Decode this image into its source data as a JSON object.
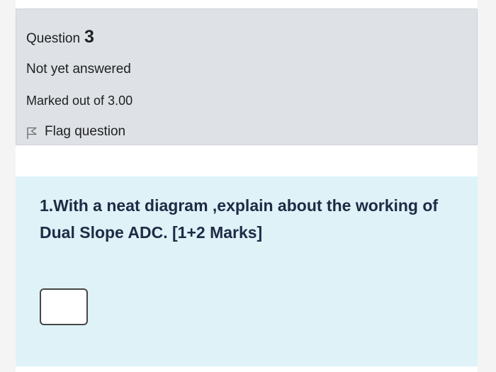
{
  "info": {
    "question_label": "Question",
    "question_number": "3",
    "state": "Not yet answered",
    "grade": "Marked out of 3.00",
    "flag_label": "Flag question",
    "flag_icon": "flag-icon"
  },
  "question": {
    "text": "1.With a neat diagram ,explain about the working of Dual Slope  ADC.  [1+2 Marks]"
  },
  "answer": {
    "value": ""
  }
}
